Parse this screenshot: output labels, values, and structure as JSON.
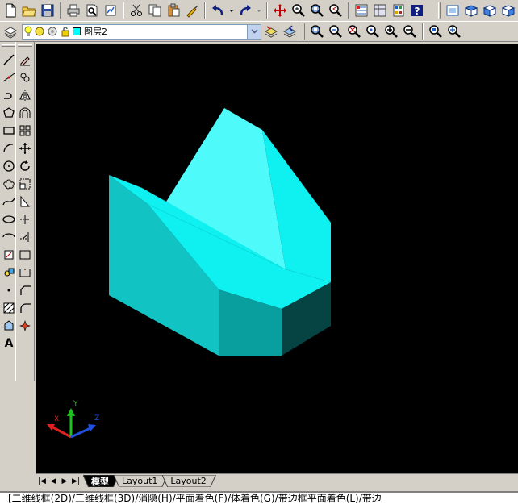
{
  "layer": {
    "name": "图层2",
    "color": "#00ffff"
  },
  "tabs": {
    "model": "模型",
    "layout1": "Layout1",
    "layout2": "Layout2"
  },
  "command_line": {
    "text": "[二维线框(2D)/三维线框(3D)/消隐(H)/平面着色(F)/体着色(G)/带边框平面着色(L)/带边"
  },
  "ucs_icon": {
    "x_label": "X",
    "y_label": "Y",
    "z_label": "Z"
  },
  "colors": {
    "canvas": "#000000",
    "solid_light": "#4ffafa",
    "solid_main": "#0ff0f0",
    "solid_mid": "#12c3c3",
    "solid_dark": "#0a9f9f",
    "solid_darkest": "#064444"
  }
}
